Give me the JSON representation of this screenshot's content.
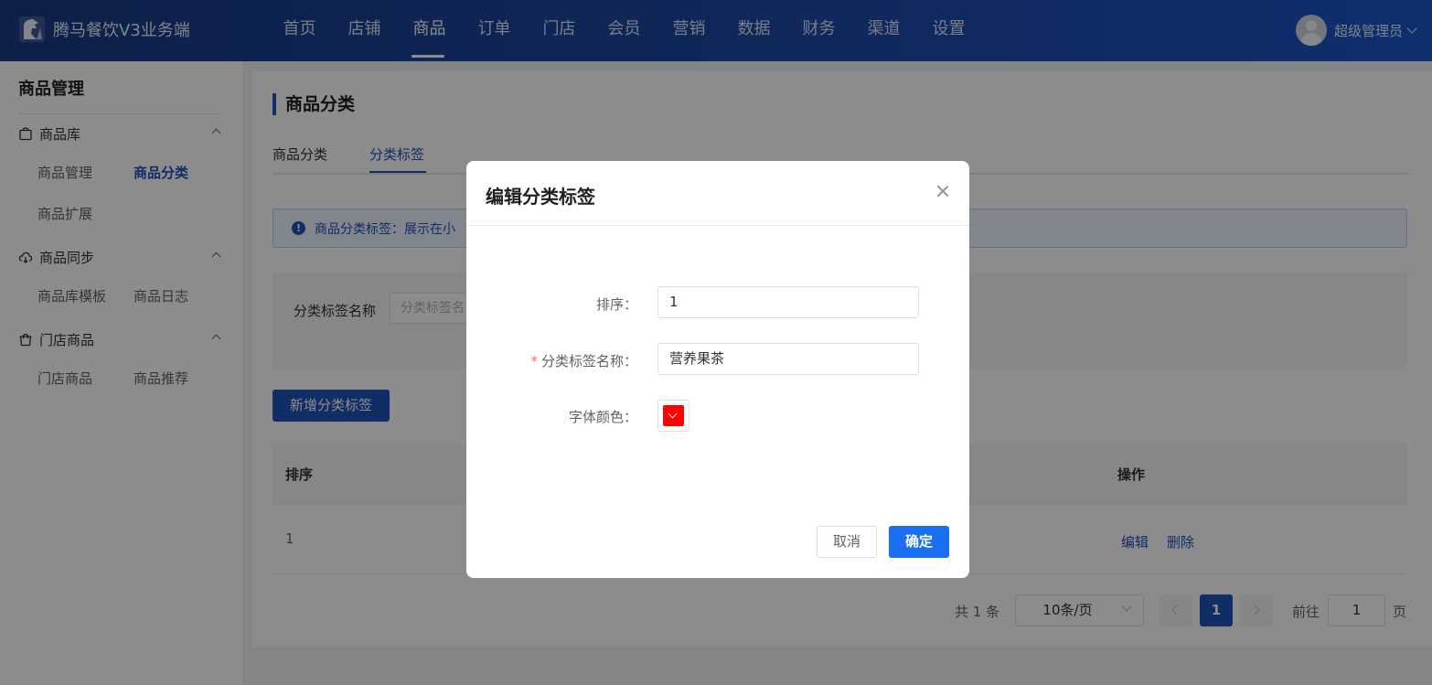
{
  "app": {
    "title": "腾马餐饮V3业务端"
  },
  "nav": {
    "items": [
      "首页",
      "店铺",
      "商品",
      "订单",
      "门店",
      "会员",
      "营销",
      "数据",
      "财务",
      "渠道",
      "设置"
    ],
    "active_index": 2
  },
  "user": {
    "name": "超级管理员"
  },
  "sidebar": {
    "title": "商品管理",
    "groups": [
      {
        "label": "商品库",
        "icon": "bag-icon",
        "items": [
          "商品管理",
          "商品分类",
          "商品扩展"
        ]
      },
      {
        "label": "商品同步",
        "icon": "cloud-sync-icon",
        "items": [
          "商品库模板",
          "商品日志"
        ]
      },
      {
        "label": "门店商品",
        "icon": "shopping-bag-icon",
        "items": [
          "门店商品",
          "商品推荐"
        ]
      }
    ],
    "active_item": "商品分类"
  },
  "page": {
    "title": "商品分类",
    "tabs": [
      "商品分类",
      "分类标签"
    ],
    "active_tab": "分类标签",
    "alert": "商品分类标签：展示在小",
    "filter": {
      "label": "分类标签名称",
      "placeholder": "分类标签名"
    },
    "add_button": "新增分类标签",
    "table": {
      "headers": {
        "sort": "排序",
        "actions": "操作"
      },
      "rows": [
        {
          "sort": "1",
          "edit": "编辑",
          "delete": "删除"
        }
      ]
    },
    "pagination": {
      "total": "共 1 条",
      "page_size": "10条/页",
      "current": "1",
      "goto_label": "前往",
      "goto_value": "1",
      "goto_unit": "页"
    }
  },
  "dialog": {
    "title": "编辑分类标签",
    "fields": {
      "sort": {
        "label": "排序：",
        "value": "1"
      },
      "name": {
        "label": "分类标签名称：",
        "required_mark": "*",
        "value": "营养果茶"
      },
      "color": {
        "label": "字体颜色：",
        "value": "#ff0000"
      }
    },
    "cancel": "取消",
    "confirm": "确定"
  },
  "colors": {
    "brand": "#1e52b8",
    "primary_button": "#1a6ff0",
    "header": "#1e4aa8"
  }
}
